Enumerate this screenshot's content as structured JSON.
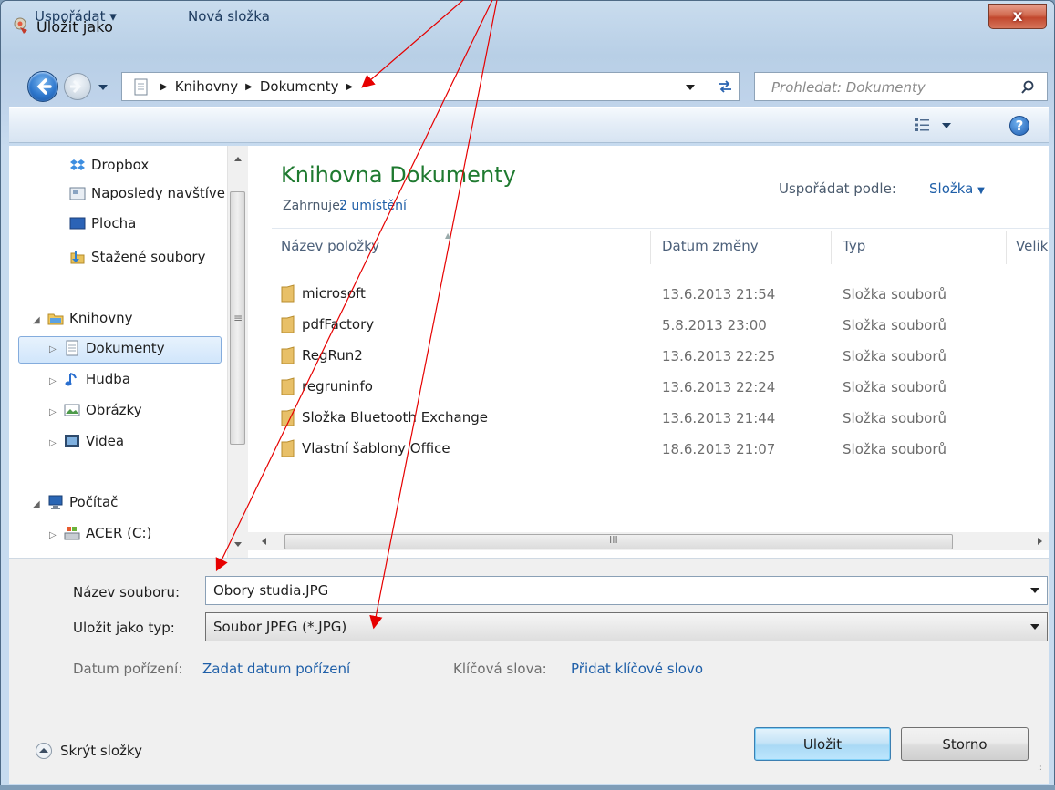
{
  "window": {
    "title": "Uložit jako",
    "close_label": "x"
  },
  "navigation": {
    "breadcrumbs": [
      "Knihovny",
      "Dokumenty"
    ],
    "search_placeholder": "Prohledat: Dokumenty"
  },
  "toolbar": {
    "organize_label": "Uspořádat ▾",
    "new_folder_label": "Nová složka"
  },
  "sidebar": {
    "items": [
      {
        "label": "Dropbox",
        "icon": "dropbox-icon"
      },
      {
        "label": "Naposledy navštívené",
        "icon": "recent-places-icon"
      },
      {
        "label": "Plocha",
        "icon": "desktop-icon"
      },
      {
        "label": "Stažené soubory",
        "icon": "downloads-icon"
      },
      {
        "label": "Knihovny",
        "icon": "libraries-icon"
      },
      {
        "label": "Dokumenty",
        "icon": "documents-icon",
        "selected": true
      },
      {
        "label": "Hudba",
        "icon": "music-icon"
      },
      {
        "label": "Obrázky",
        "icon": "pictures-icon"
      },
      {
        "label": "Videa",
        "icon": "videos-icon"
      },
      {
        "label": "Počítač",
        "icon": "computer-icon"
      },
      {
        "label": "ACER (C:)",
        "icon": "drive-icon"
      }
    ]
  },
  "library": {
    "title": "Knihovna Dokumenty",
    "includes_label": "Zahrnuje:",
    "includes_link": "2 umístění",
    "arrange_label": "Uspořádat podle:",
    "arrange_value": "Složka"
  },
  "columns": [
    "Název položky",
    "Datum změny",
    "Typ",
    "Velik"
  ],
  "files": [
    {
      "name": "microsoft",
      "date": "13.6.2013 21:54",
      "type": "Složka souborů"
    },
    {
      "name": "pdfFactory",
      "date": "5.8.2013 23:00",
      "type": "Složka souborů"
    },
    {
      "name": "RegRun2",
      "date": "13.6.2013 22:25",
      "type": "Složka souborů"
    },
    {
      "name": "regruninfo",
      "date": "13.6.2013 22:24",
      "type": "Složka souborů"
    },
    {
      "name": "Složka Bluetooth Exchange",
      "date": "13.6.2013 21:44",
      "type": "Složka souborů"
    },
    {
      "name": "Vlastní šablony Office",
      "date": "18.6.2013 21:07",
      "type": "Složka souborů"
    }
  ],
  "form": {
    "filename_label": "Název souboru:",
    "filename_value": "Obory studia.JPG",
    "filetype_label": "Uložit jako typ:",
    "filetype_value": "Soubor JPEG (*.JPG)",
    "date_label": "Datum pořízení:",
    "date_link": "Zadat datum pořízení",
    "keywords_label": "Klíčová slova:",
    "keywords_link": "Přidat klíčové slovo"
  },
  "footer": {
    "hide_folders_label": "Skrýt složky",
    "save_label": "Uložit",
    "cancel_label": "Storno"
  },
  "annotation_color": "#e60000"
}
